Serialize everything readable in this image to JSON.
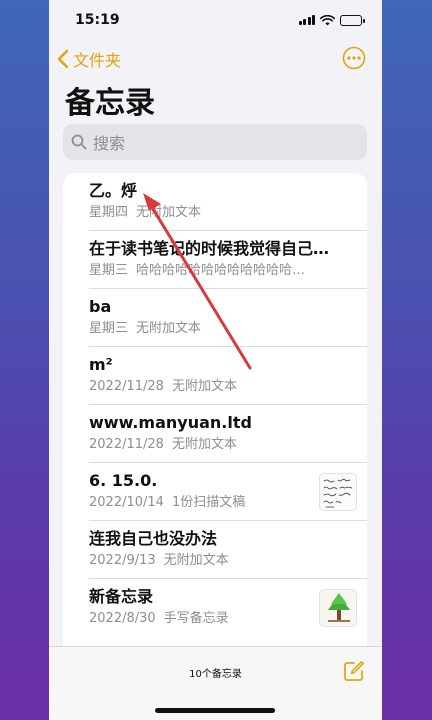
{
  "status_bar": {
    "time": "15:19"
  },
  "nav": {
    "back_label": "文件夹"
  },
  "title": "备忘录",
  "search": {
    "placeholder": "搜索"
  },
  "notes": [
    {
      "title": "乙。烀",
      "date": "星期四",
      "preview": "无附加文本"
    },
    {
      "title": "在于读书笔记的时候我觉得自己…",
      "date": "星期三",
      "preview": "哈哈哈哈哈哈哈哈哈哈哈哈…"
    },
    {
      "title": "ba",
      "date": "星期三",
      "preview": "无附加文本"
    },
    {
      "title": "m²",
      "date": "2022/11/28",
      "preview": "无附加文本"
    },
    {
      "title": "www.manyuan.ltd",
      "date": "2022/11/28",
      "preview": "无附加文本"
    },
    {
      "title": "6. 15.0.",
      "date": "2022/10/14",
      "preview": "1份扫描文稿",
      "thumbnail": "scanned-document-thumbnail"
    },
    {
      "title": "连我自己也没办法",
      "date": "2022/9/13",
      "preview": "无附加文本"
    },
    {
      "title": "新备忘录",
      "date": "2022/8/30",
      "preview": "手写备忘录",
      "thumbnail": "tree-drawing-thumbnail"
    }
  ],
  "bottom_bar": {
    "count_label": "10个备忘录"
  },
  "colors": {
    "accent": "#e3a30a",
    "annotation_arrow": "#d9393b"
  },
  "icons": {
    "back": "chevron-left-icon",
    "more": "ellipsis-circle-icon",
    "search": "search-icon",
    "compose": "compose-icon"
  }
}
